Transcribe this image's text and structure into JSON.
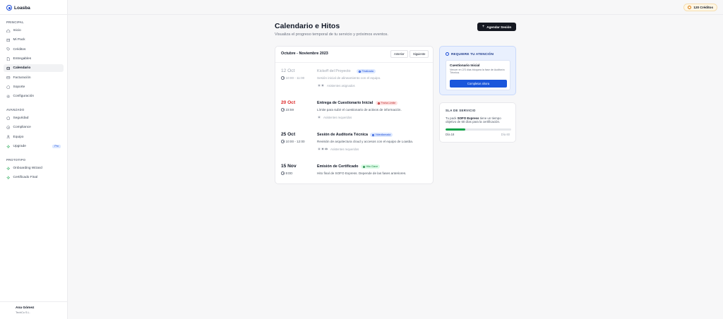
{
  "brand": {
    "name": "Loasba",
    "icon": "shield-icon"
  },
  "sidebar": {
    "principal_label": "PRINCIPAL",
    "avanzado_label": "AVANZADO",
    "prototipo_label": "PROTOTIPO",
    "principal": [
      {
        "label": "Inicio",
        "icon": "home-icon"
      },
      {
        "label": "Mi Pack",
        "icon": "package-icon"
      },
      {
        "label": "Créditos",
        "icon": "tag-icon"
      },
      {
        "label": "Entregables",
        "icon": "file-icon"
      },
      {
        "label": "Calendario",
        "icon": "calendar-icon",
        "active": true
      },
      {
        "label": "Facturación",
        "icon": "card-icon"
      },
      {
        "label": "Soporte",
        "icon": "help-icon"
      },
      {
        "label": "Configuración",
        "icon": "gear-icon"
      }
    ],
    "avanzado": [
      {
        "label": "Seguridad",
        "icon": "shield-icon"
      },
      {
        "label": "Compliance",
        "icon": "check-icon"
      },
      {
        "label": "Equipo",
        "icon": "users-icon"
      },
      {
        "label": "Upgrade",
        "icon": "sparkle-icon",
        "badge": "Pro"
      }
    ],
    "prototipo": [
      {
        "label": "Onboarding Wizard",
        "icon": "sparkle-icon"
      },
      {
        "label": "Certificado Final",
        "icon": "sparkle-icon"
      }
    ]
  },
  "user": {
    "name": "Ana Gómez",
    "org": "TechCo S.L."
  },
  "credits": {
    "label": "120 Créditos"
  },
  "page": {
    "title": "Calendario e Hitos",
    "subtitle": "Visualiza el progreso temporal de tu servicio y próximos eventos.",
    "schedule_button": "Agendar Sesión"
  },
  "timeline": {
    "range": "Octubre - Noviembre 2023",
    "prev_label": "Anterior",
    "next_label": "Siguiente",
    "events": [
      {
        "date": "12 Oct",
        "time": "10:00 - 11:00",
        "title": "Kickoff del Proyecto",
        "badge": "Finalizada",
        "badge_style": "blue",
        "description": "Sesión inicial de alineamiento con el equipo.",
        "avatars": [
          "A",
          "D"
        ],
        "people": "Asistentes asignados",
        "muted": true
      },
      {
        "date": "20 Oct",
        "time": "23:59",
        "title": "Entrega de Cuestionario Inicial",
        "badge": "Fecha Límite",
        "badge_style": "red",
        "description": "Límite para subir el cuestionario de activos de información.",
        "avatars": [
          "A"
        ],
        "people": "Asistentes requeridos",
        "date_style": "red"
      },
      {
        "date": "25 Oct",
        "time": "10:00 - 12:00",
        "title": "Sesión de Auditoría Técnica",
        "badge": "Videollamada",
        "badge_style": "blue",
        "description": "Revisión de arquitectura cloud y accesos con el equipo de Loasba.",
        "avatars": [
          "A",
          "M",
          "AG"
        ],
        "people": "Asistentes requeridos"
      },
      {
        "date": "15 Nov",
        "time": "EOD",
        "title": "Emisión de Certificado",
        "badge": "Hito Clave",
        "badge_style": "green",
        "description": "Hito final de SOFO Express. Depende de las fases anteriores."
      }
    ]
  },
  "attention": {
    "heading": "REQUIERE TU ATENCIÓN",
    "item_title": "Cuestionario Inicial",
    "item_desc": "Vencer en 2/3 días bloquea la fase de Auditoría Técnica.",
    "button": "Completar ahora"
  },
  "sla": {
    "heading": "SLA DE SERVICIO",
    "text_pre": "Tu pack ",
    "text_bold": "SOFO Express",
    "text_post": " tiene un tiempo objetivo de 60 días para la certificación.",
    "progress": 0.3,
    "left_label": "Día 18",
    "right_label": "Día 60"
  },
  "colors": {
    "accent": "#1a56db",
    "dark_button": "#151821",
    "danger": "#dc2626",
    "success": "#16a34a"
  }
}
